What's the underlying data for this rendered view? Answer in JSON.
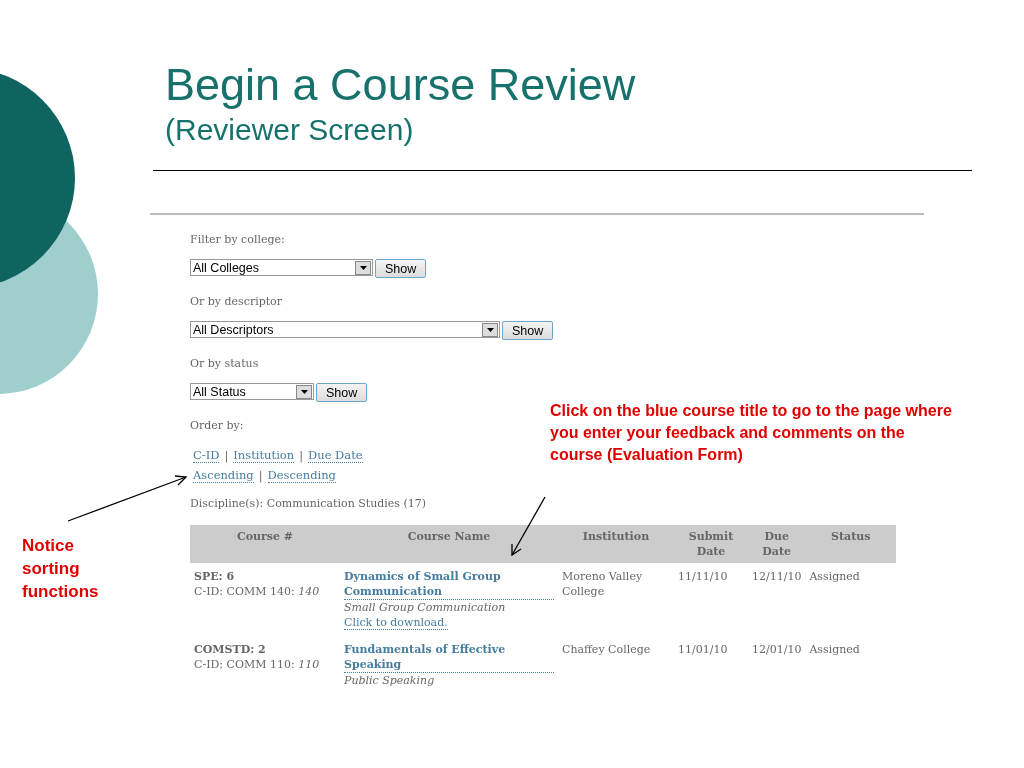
{
  "slide": {
    "title": "Begin a Course Review",
    "subtitle": "(Reviewer Screen)"
  },
  "filters": [
    {
      "label": "Filter by college:",
      "value": "All Colleges",
      "button": "Show"
    },
    {
      "label": "Or by descriptor",
      "value": "All Descriptors",
      "button": "Show"
    },
    {
      "label": "Or by status",
      "value": "All Status",
      "button": "Show"
    }
  ],
  "order_by": {
    "label": "Order by:",
    "lines": [
      [
        {
          "kind": "link",
          "text": "C-ID"
        },
        {
          "kind": "separator",
          "text": "|"
        },
        {
          "kind": "link",
          "text": "Institution"
        },
        {
          "kind": "separator",
          "text": "|"
        },
        {
          "kind": "link",
          "text": "Due Date"
        }
      ],
      [
        {
          "kind": "link",
          "text": "Ascending"
        },
        {
          "kind": "separator",
          "text": "|"
        },
        {
          "kind": "link",
          "text": "Descending"
        }
      ]
    ]
  },
  "discipline": "Discipline(s): Communication Studies (17)",
  "table": {
    "columns": [
      "Course #",
      "Course Name",
      "Institution",
      "Submit Date",
      "Due Date",
      "Status"
    ],
    "rows": [
      {
        "course_number": "SPE: 6",
        "cid": "C-ID: COMM 140: *140*",
        "course_name": "Dynamics of Small Group Communication",
        "course_alt": "Small Group Communication",
        "download": "Click to download.",
        "institution": "Moreno Valley College",
        "submit_date": "11/11/10",
        "due_date": "12/11/10",
        "status": "Assigned"
      },
      {
        "course_number": "COMSTD: 2",
        "cid": "C-ID: COMM 110: *110*",
        "course_name": "Fundamentals of Effective Speaking",
        "course_alt": "Public Speaking",
        "institution": "Chaffey College",
        "submit_date": "11/01/10",
        "due_date": "12/01/10",
        "status": "Assigned"
      }
    ]
  },
  "annotations": [
    {
      "kind": "callout",
      "text": "Click on the blue course title to go to the page where you enter your feedback and comments on the course (Evaluation Form)"
    },
    {
      "kind": "note",
      "text": "Notice sorting functions"
    }
  ]
}
